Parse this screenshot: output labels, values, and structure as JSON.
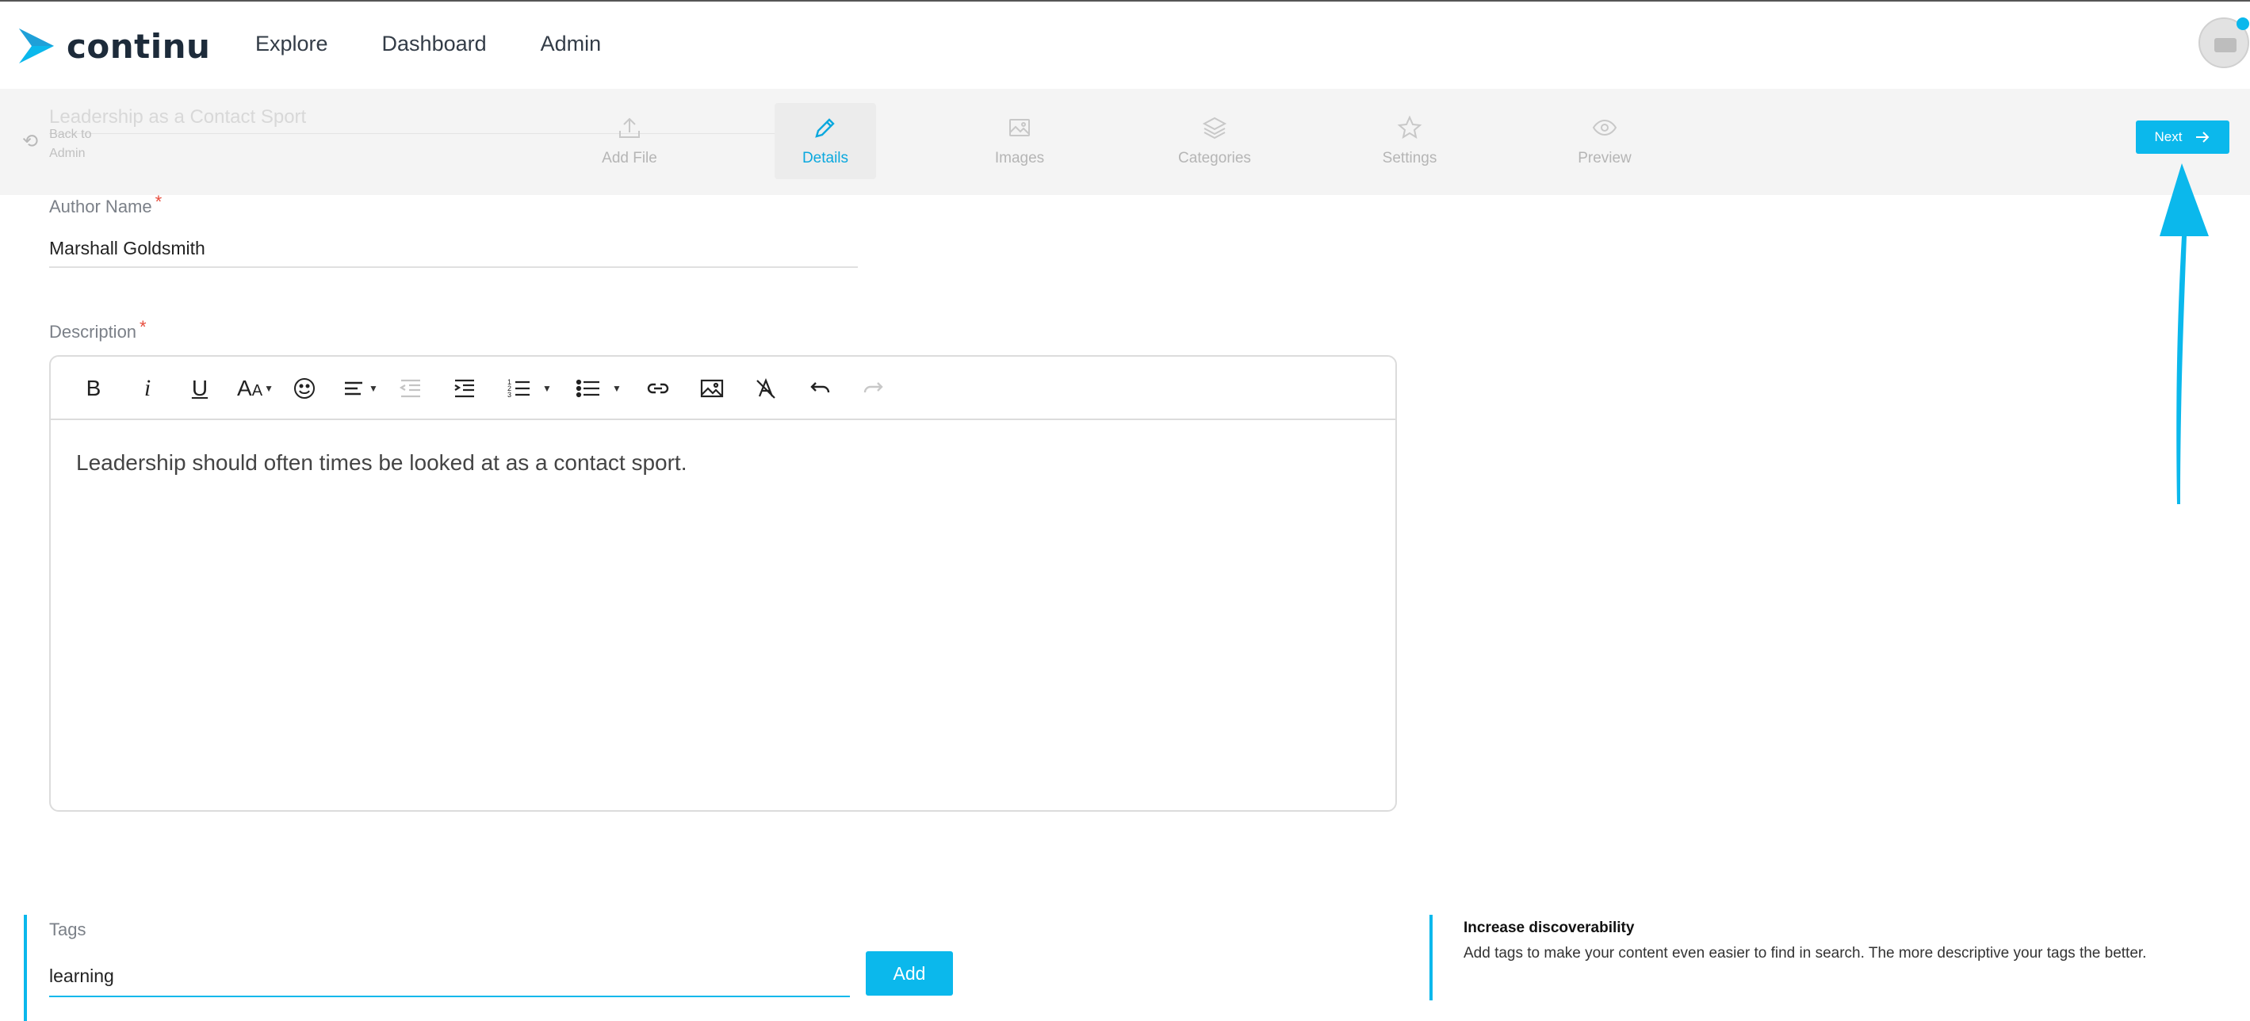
{
  "app": {
    "logo_text": "continu",
    "brand_color": "#0bb8ec"
  },
  "nav": {
    "items": [
      "Explore",
      "Dashboard",
      "Admin"
    ]
  },
  "stepbar": {
    "course_title": "Leadership as a Contact Sport",
    "back_label": "Back to Admin",
    "steps": [
      {
        "label": "Add File",
        "icon": "upload-icon",
        "active": false
      },
      {
        "label": "Details",
        "icon": "pencil-icon",
        "active": true
      },
      {
        "label": "Images",
        "icon": "image-icon",
        "active": false
      },
      {
        "label": "Categories",
        "icon": "layers-icon",
        "active": false
      },
      {
        "label": "Settings",
        "icon": "star-icon",
        "active": false
      },
      {
        "label": "Preview",
        "icon": "eye-icon",
        "active": false
      }
    ],
    "next_label": "Next"
  },
  "form": {
    "author_label": "Author Name",
    "author_value": "Marshall Goldsmith",
    "description_label": "Description",
    "description_text": "Leadership should often times be looked at as a contact sport.",
    "required_mark": "*"
  },
  "tags": {
    "label": "Tags",
    "value": "learning",
    "add_label": "Add"
  },
  "info": {
    "title": "Increase discoverability",
    "text": "Add tags to make your content even easier to find in search. The more descriptive your tags the better."
  }
}
